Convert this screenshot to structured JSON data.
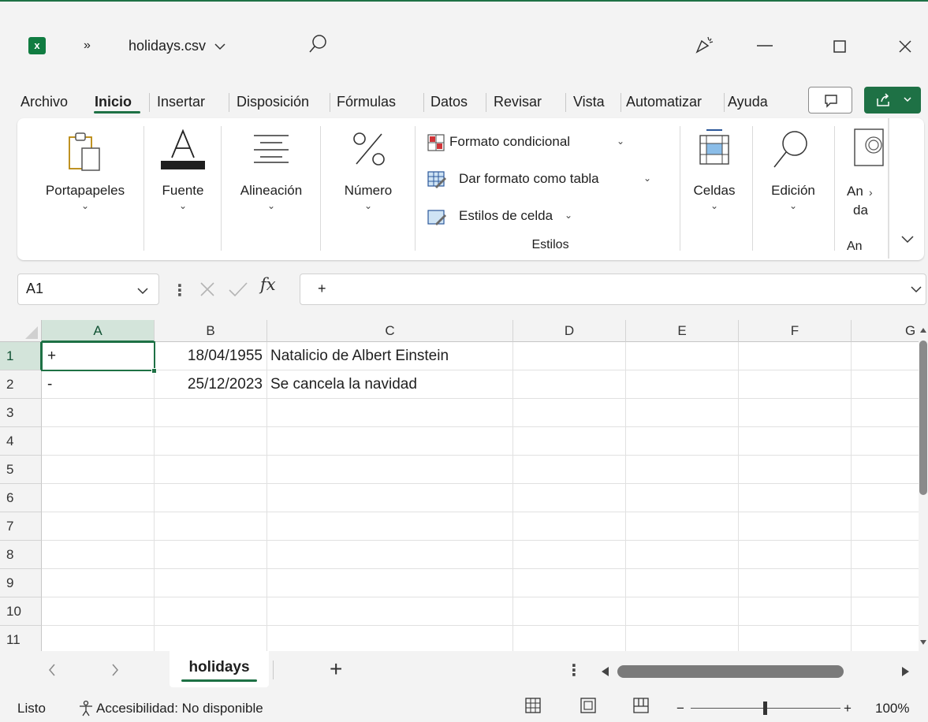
{
  "window": {
    "file_name": "holidays.csv",
    "overflow_label": "»",
    "file_chevron": "v"
  },
  "tabs": [
    "Archivo",
    "Inicio",
    "Insertar",
    "Disposición",
    "Fórmulas",
    "Datos",
    "Revisar",
    "Vista",
    "Automatizar",
    "Ayuda"
  ],
  "ribbon": {
    "groups": {
      "clipboard": "Portapapeles",
      "font": "Fuente",
      "alignment": "Alineación",
      "number": "Número",
      "cells": "Celdas",
      "editing": "Edición",
      "analyze_top": "An",
      "analyze_mid": "da",
      "analyze_bottom": "An"
    },
    "styles": {
      "conditional": "Formato condicional",
      "as_table": "Dar formato como tabla",
      "cell_styles": "Estilos de celda",
      "group_label": "Estilos"
    }
  },
  "formula_bar": {
    "name_box": "A1",
    "fx_label": "fx",
    "content": "+"
  },
  "sheet": {
    "columns": [
      "A",
      "B",
      "C",
      "D",
      "E",
      "F",
      "G"
    ],
    "rows": [
      "1",
      "2",
      "3",
      "4",
      "5",
      "6",
      "7",
      "8",
      "9",
      "10",
      "11"
    ],
    "cells": {
      "A1": "+",
      "B1": "18/04/1955",
      "C1": "Natalicio de Albert Einstein",
      "A2": "-",
      "B2": "25/12/2023",
      "C2": "Se cancela la navidad"
    },
    "selected_cell": "A1"
  },
  "sheet_tabs": {
    "active": "holidays",
    "add_label": "+"
  },
  "status_bar": {
    "ready": "Listo",
    "accessibility": "Accesibilidad: No disponible",
    "zoom": "100%",
    "zoom_minus": "−",
    "zoom_plus": "+",
    "zoom_level": 1.0
  },
  "colors": {
    "accent": "#1e7145",
    "excel_green": "#107c41"
  }
}
